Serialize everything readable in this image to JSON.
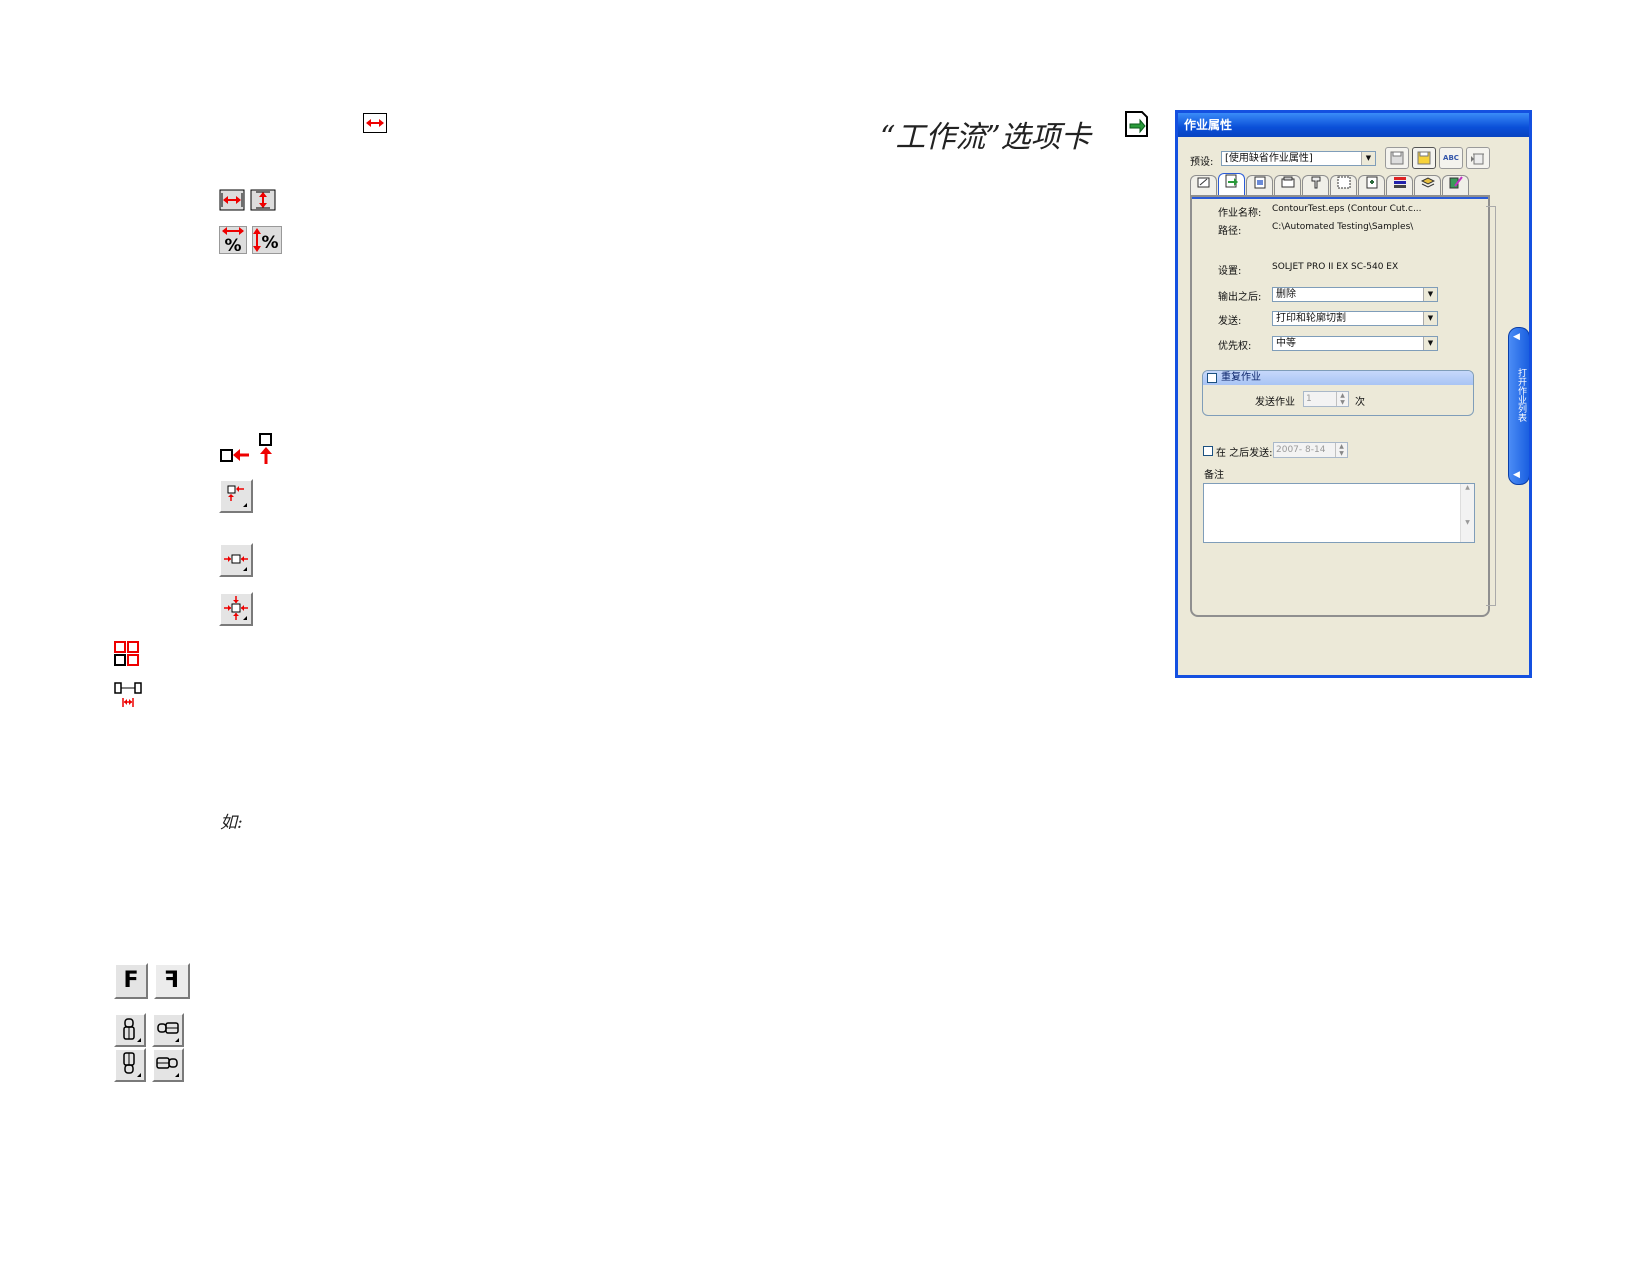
{
  "heading": "“工作流”选项卡",
  "example_label": "如:",
  "icons": {
    "f_normal": "F",
    "f_mirror": "F"
  },
  "panel": {
    "title": "作业属性",
    "preset_label": "预设:",
    "preset_value": "[使用缺省作业属性]",
    "toolbar_buttons": [
      "save-icon",
      "save-as-icon",
      "spellcheck-icon",
      "delete-icon"
    ],
    "toolbar_abc": "ABC",
    "tabs": [
      "general-icon",
      "workflow-icon",
      "preview-icon",
      "size-icon",
      "cut-icon",
      "tile-icon",
      "nest-icon",
      "color-icon",
      "media-icon",
      "edit-icon"
    ],
    "job_name_label": "作业名称:",
    "job_name_value": "ContourTest.eps (Contour Cut.c...",
    "path_label": "路径:",
    "path_value": "C:\\Automated Testing\\Samples\\",
    "setup_label": "设置:",
    "setup_value": "SOLJET PRO II EX SC-540 EX",
    "after_output_label": "输出之后:",
    "after_output_value": "删除",
    "send_label": "发送:",
    "send_value": "打印和轮廓切割",
    "priority_label": "优先权:",
    "priority_value": "中等",
    "repeat_job_label": "重复作业",
    "send_job_label": "发送作业",
    "send_job_count": "1",
    "times_label": "次",
    "send_after_label": "在 之后发送:",
    "send_after_value": "2007- 8-14",
    "notes_label": "备注",
    "side_tab_label": "打开作业列表"
  }
}
